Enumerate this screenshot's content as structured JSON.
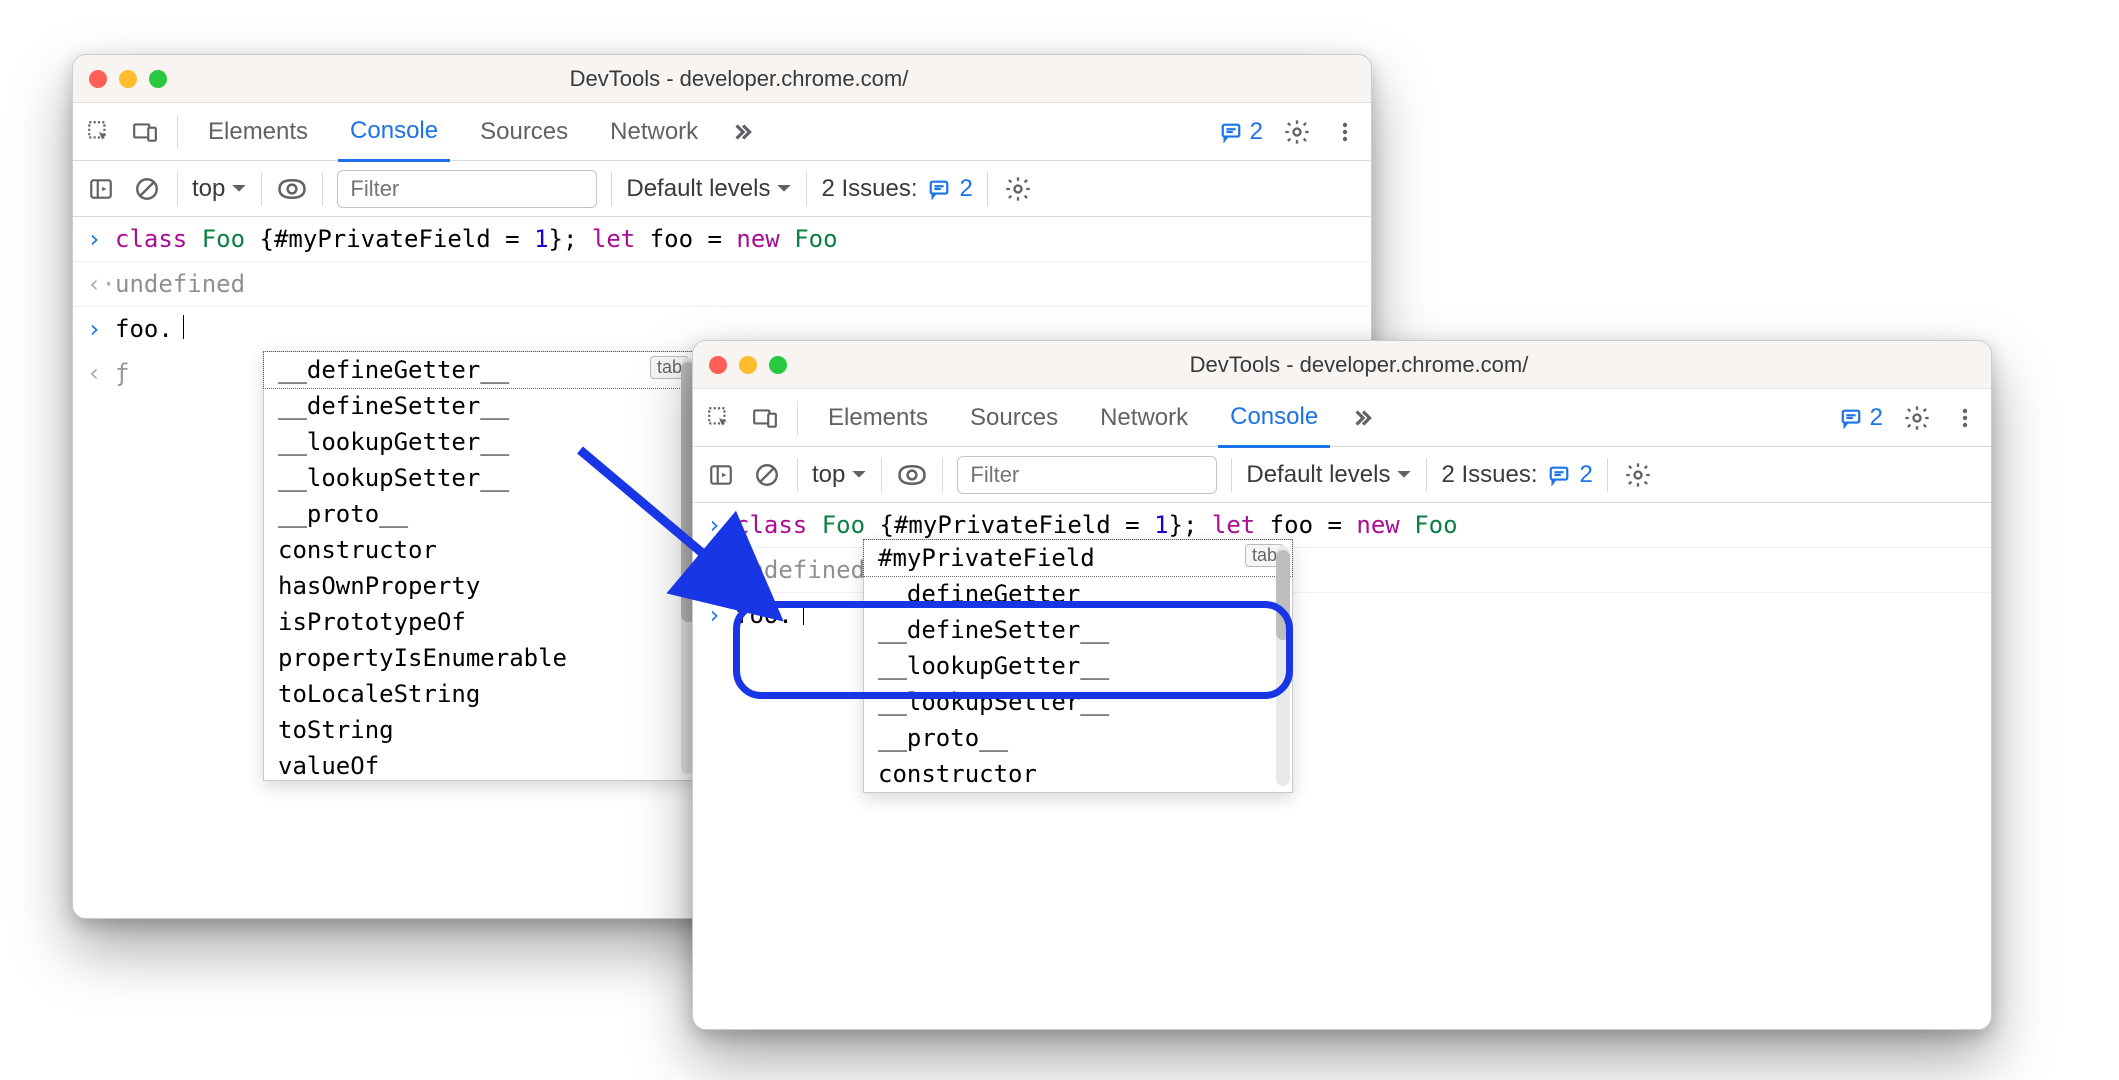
{
  "window1": {
    "title": "DevTools - developer.chrome.com/",
    "tabs": [
      "Elements",
      "Console",
      "Sources",
      "Network"
    ],
    "active_tab": "Console",
    "messages_count": "2",
    "toolbar": {
      "context": "top",
      "filter_placeholder": "Filter",
      "levels": "Default levels",
      "issues_label": "2 Issues:",
      "issues_count": "2"
    },
    "console": {
      "input_line_tokens": [
        "class",
        "Foo",
        "{#myPrivateField = ",
        "1",
        "}; ",
        "let",
        " foo = ",
        "new",
        " Foo"
      ],
      "input_line_text": "class Foo {#myPrivateField = 1}; let foo = new Foo",
      "result": "undefined",
      "typed": "foo.",
      "fn_preview": "ƒ"
    },
    "autocomplete": [
      "__defineGetter__",
      "__defineSetter__",
      "__lookupGetter__",
      "__lookupSetter__",
      "__proto__",
      "constructor",
      "hasOwnProperty",
      "isPrototypeOf",
      "propertyIsEnumerable",
      "toLocaleString",
      "toString",
      "valueOf"
    ],
    "tab_hint": "tab"
  },
  "window2": {
    "title": "DevTools - developer.chrome.com/",
    "tabs": [
      "Elements",
      "Sources",
      "Network",
      "Console"
    ],
    "active_tab": "Console",
    "messages_count": "2",
    "toolbar": {
      "context": "top",
      "filter_placeholder": "Filter",
      "levels": "Default levels",
      "issues_label": "2 Issues:",
      "issues_count": "2"
    },
    "console": {
      "input_line_text": "class Foo {#myPrivateField = 1}; let foo = new Foo",
      "result": "undefined",
      "typed": "foo."
    },
    "autocomplete": [
      "#myPrivateField",
      "__defineGetter__",
      "__defineSetter__",
      "__lookupGetter__",
      "__lookupSetter__",
      "__proto__",
      "constructor"
    ],
    "tab_hint": "tab"
  }
}
